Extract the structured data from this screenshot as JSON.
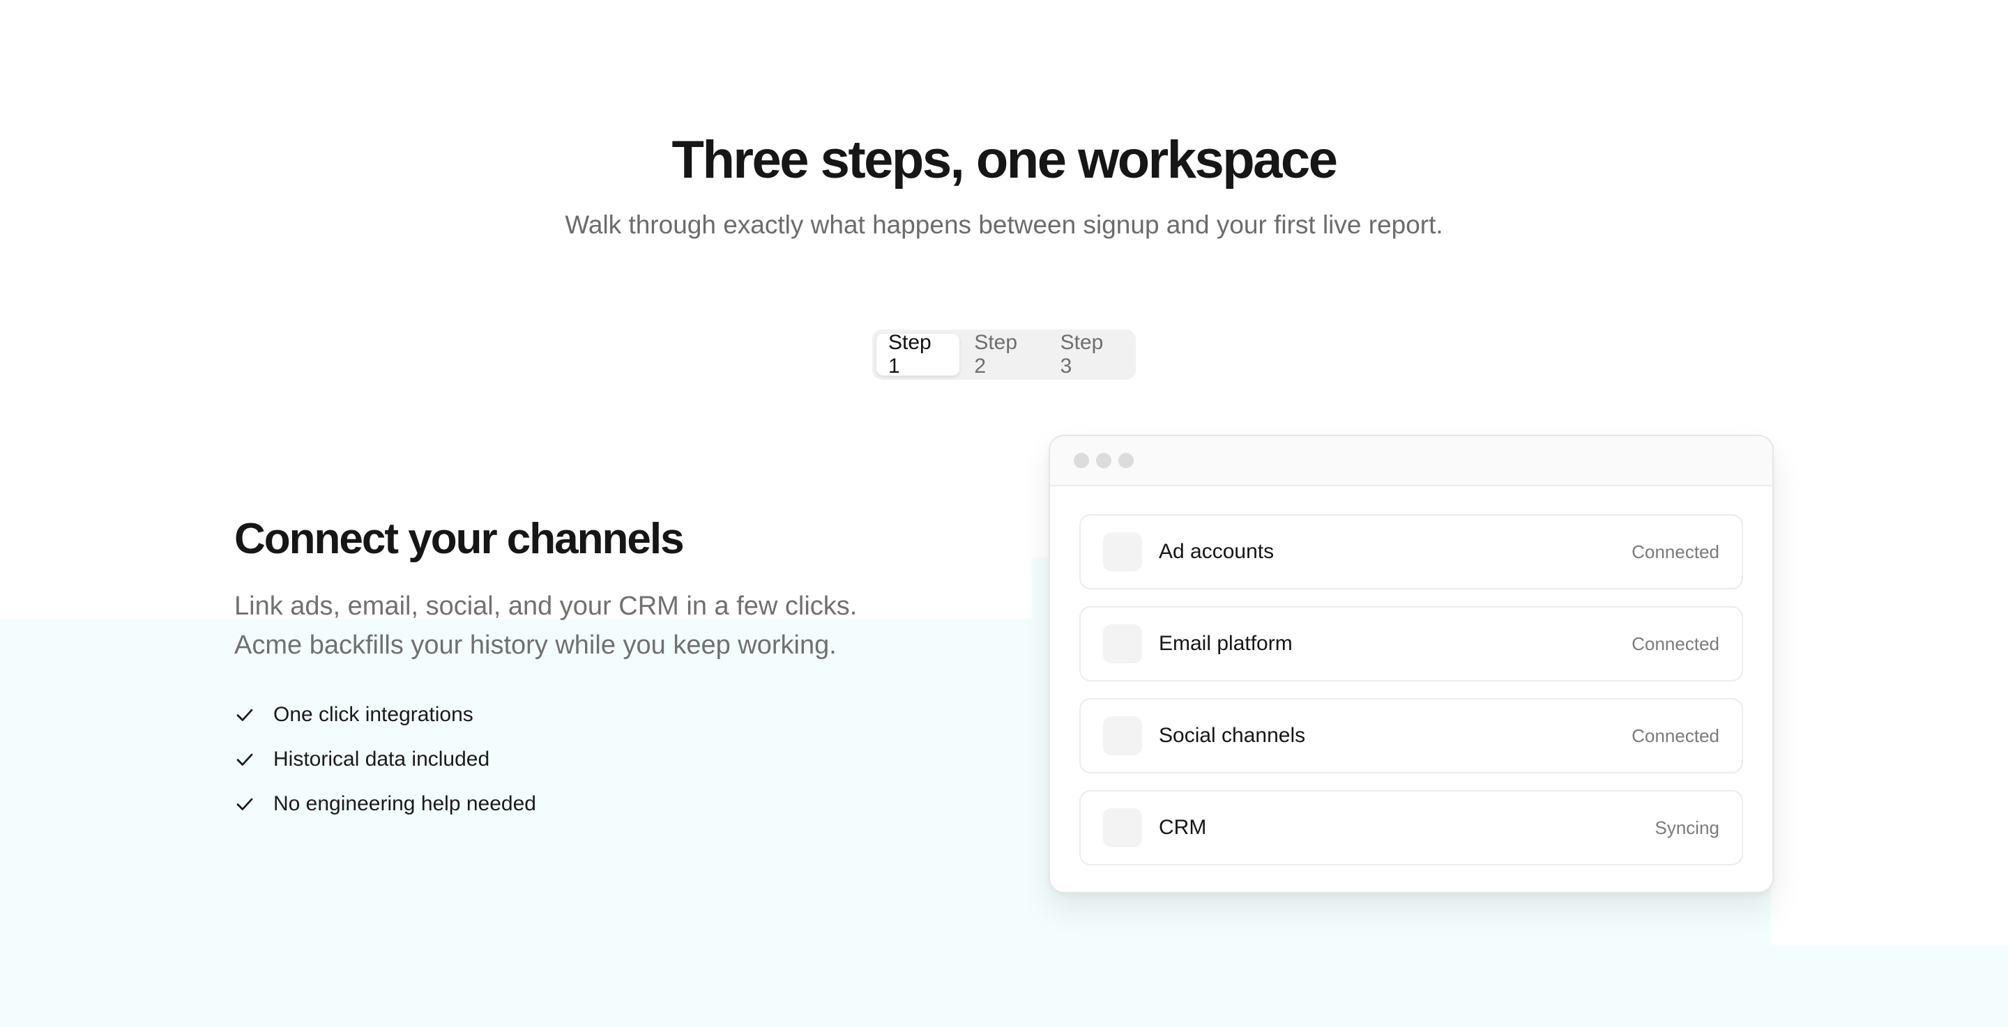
{
  "hero": {
    "title": "Three steps, one workspace",
    "subtitle": "Walk through exactly what happens between signup and your first live report."
  },
  "tabs": [
    {
      "label": "Step 1",
      "active": true
    },
    {
      "label": "Step 2",
      "active": false
    },
    {
      "label": "Step 3",
      "active": false
    }
  ],
  "step": {
    "title": "Connect your channels",
    "description_line1": "Link ads, email, social, and your CRM in a few clicks.",
    "description_line2": "Acme backfills your history while you keep working.",
    "checklist": [
      "One click integrations",
      "Historical data included",
      "No engineering help needed"
    ]
  },
  "window": {
    "rows": [
      {
        "name": "Ad accounts",
        "status": "Connected"
      },
      {
        "name": "Email platform",
        "status": "Connected"
      },
      {
        "name": "Social channels",
        "status": "Connected"
      },
      {
        "name": "CRM",
        "status": "Syncing"
      }
    ]
  },
  "icons": {
    "check": "check-icon",
    "row": "integration-icon",
    "window_dots": "window-control-dot"
  },
  "colors": {
    "background_tint": "#f4fdfd",
    "heading": "#161616",
    "muted_text": "#6b6b6b",
    "tab_active_bg": "#ffffff",
    "tab_track_bg": "#f1f1f1"
  }
}
